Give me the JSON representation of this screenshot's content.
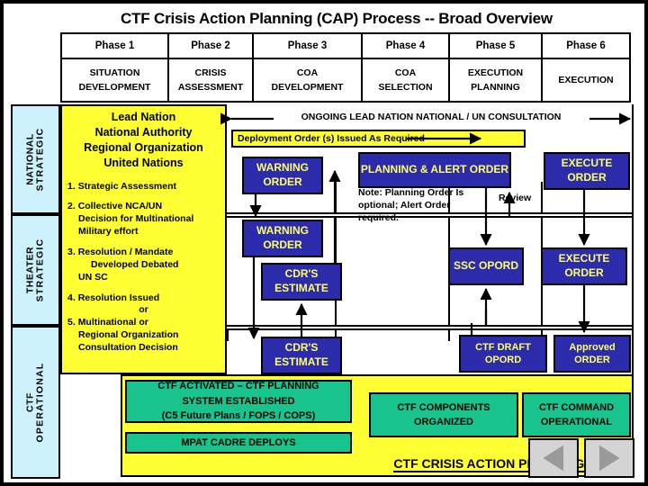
{
  "title": "CTF Crisis Action Planning (CAP) Process -- Broad Overview",
  "colors": {
    "order_box": "#2b2bab",
    "order_text": "#ffff66",
    "panel_yellow": "#ffff33",
    "lane_cyan": "#cdf2fd",
    "green_box": "#18c48c",
    "nav_gray": "#d4d4d4"
  },
  "phases": [
    {
      "label": "Phase 1",
      "line1": "SITUATION",
      "line2": "DEVELOPMENT"
    },
    {
      "label": "Phase 2",
      "line1": "CRISIS",
      "line2": "ASSESSMENT"
    },
    {
      "label": "Phase 3",
      "line1": "COA",
      "line2": "DEVELOPMENT"
    },
    {
      "label": "Phase 4",
      "line1": "COA",
      "line2": "SELECTION"
    },
    {
      "label": "Phase 5",
      "line1": "EXECUTION",
      "line2": "PLANNING"
    },
    {
      "label": "Phase 6",
      "line1": "EXECUTION",
      "line2": ""
    }
  ],
  "lanes": [
    {
      "line1": "NATIONAL",
      "line2": "STRATEGIC"
    },
    {
      "line1": "THEATER",
      "line2": "STRATEGIC"
    },
    {
      "line1": "CTF",
      "line2": "OPERATIONAL"
    }
  ],
  "left_panel": {
    "heading": [
      "Lead Nation",
      "National Authority",
      "Regional Organization",
      "United Nations"
    ],
    "items": [
      {
        "num": "1.",
        "lines": [
          "Strategic Assessment"
        ]
      },
      {
        "num": "2.",
        "lines": [
          "Collective NCA/UN",
          "Decision for Multinational",
          "Military effort"
        ]
      },
      {
        "num": "3.",
        "lines": [
          "Resolution / Mandate",
          "Developed Debated",
          "UN SC"
        ]
      },
      {
        "num": "4.",
        "lines": [
          "Resolution Issued",
          "or"
        ]
      },
      {
        "num": "5.",
        "lines": [
          "Multinational or",
          "Regional Organization",
          "Consultation Decision"
        ]
      }
    ]
  },
  "ongoing_consultation": "ONGOING LEAD NATION NATIONAL / UN CONSULTATION",
  "deployment_bar": "Deployment Order (s) Issued As Required",
  "note": "Note:  Planning Order Is optional; Alert Order required.",
  "review_label": "Review",
  "order_boxes": {
    "warning_order_ns": "WARNING ORDER",
    "planning_alert_order": "PLANNING & ALERT ORDER",
    "execute_order_ns": "EXECUTE ORDER",
    "warning_order_ts": "WARNING ORDER",
    "cdrs_estimate_ts": "CDR'S ESTIMATE",
    "ssc_opord": "SSC OPORD",
    "execute_order_ts": "EXECUTE ORDER",
    "cdrs_estimate_op": "CDR'S ESTIMATE",
    "ctf_draft_opord": "CTF DRAFT OPORD",
    "approved_order": "Approved ORDER"
  },
  "green_boxes": {
    "ctf_activated": [
      "CTF ACTIVATED – CTF PLANNING",
      "SYSTEM ESTABLISHED",
      "(C5 Future Plans / FOPS / COPS)"
    ],
    "mpat_cadre": [
      "MPAT CADRE DEPLOYS"
    ],
    "ctf_components": [
      "CTF COMPONENTS",
      "ORGANIZED"
    ],
    "ctf_command": [
      "CTF COMMAND",
      "OPERATIONAL"
    ]
  },
  "bottom_title": "CTF CRISIS ACTION PLANNING (CAP)",
  "nav": {
    "prev": "◀",
    "next": "▶"
  }
}
